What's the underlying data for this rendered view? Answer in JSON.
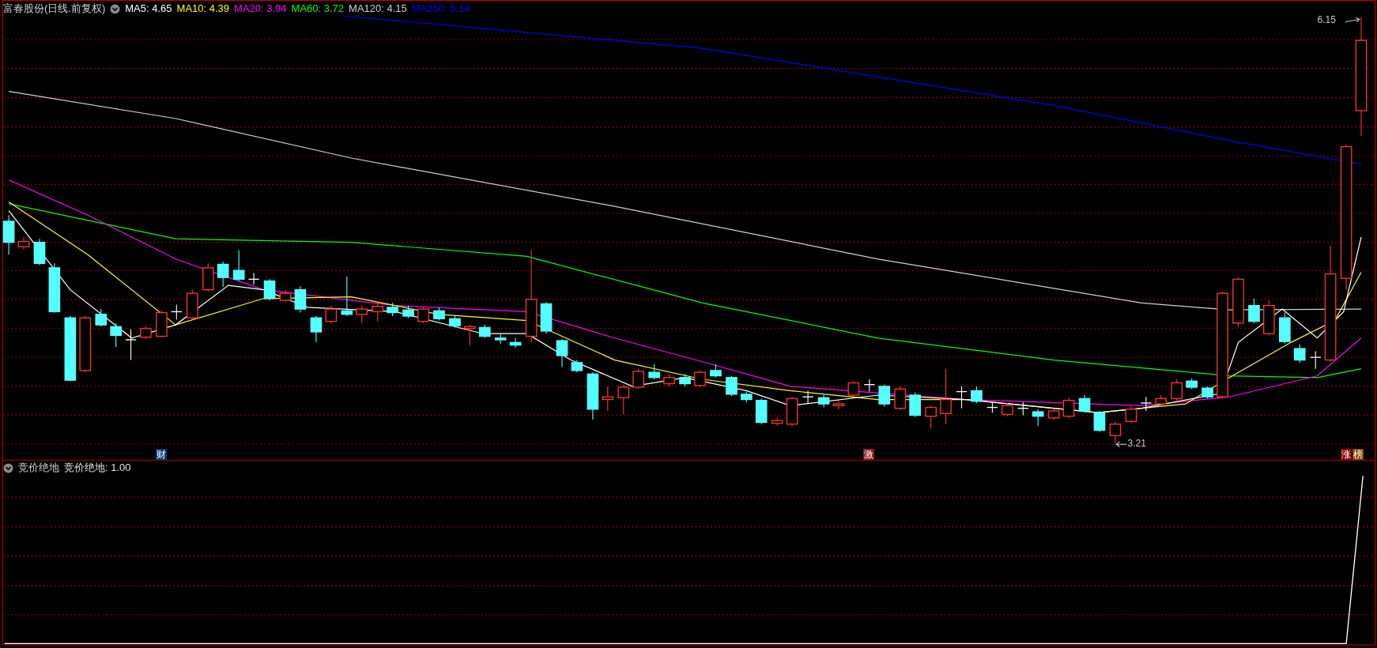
{
  "header": {
    "stock_name": "富春股份(日线.前复权)",
    "indicators": [
      {
        "label": "MA5: 4.65",
        "color": "#ffffff"
      },
      {
        "label": "MA10: 4.39",
        "color": "#ffff00"
      },
      {
        "label": "MA20: 3.94",
        "color": "#ff00ff"
      },
      {
        "label": "MA60: 3.72",
        "color": "#00ff00"
      },
      {
        "label": "MA120: 4.15",
        "color": "#d0d0d0"
      },
      {
        "label": "MA250: 5.14",
        "color": "#0000ff"
      }
    ]
  },
  "price_labels": [
    {
      "text": "6.15",
      "kind": "high"
    },
    {
      "text": "3.21",
      "kind": "low"
    }
  ],
  "event_markers": [
    {
      "text": "财",
      "color": "#0b3c78"
    },
    {
      "text": "激",
      "color": "#8b1a1a"
    },
    {
      "text": "涨",
      "color": "#8b0000"
    },
    {
      "text": "榜",
      "color": "#8b4a00"
    }
  ],
  "lower_panel": {
    "title": "竞价绝地",
    "reading": "竞价绝地: 1.00"
  }
}
